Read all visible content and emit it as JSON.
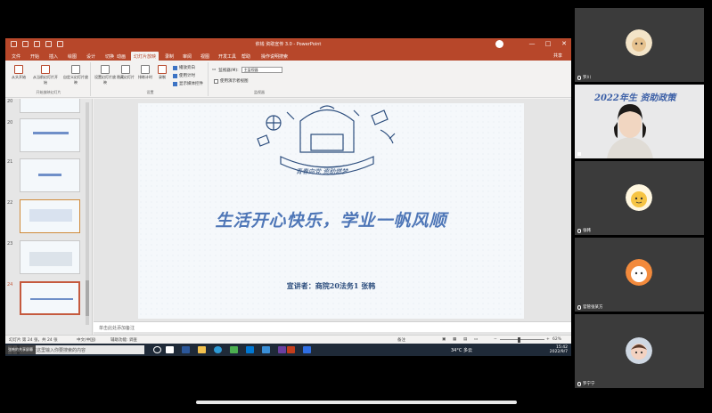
{
  "app": {
    "window_title": "依钱 资助宣传 3.0  -  PowerPoint",
    "tabs": [
      "文件",
      "开始",
      "插入",
      "绘图",
      "设计",
      "切换",
      "动画",
      "幻灯片放映",
      "录制",
      "审阅",
      "视图",
      "开发工具",
      "帮助",
      "操作说明搜索"
    ],
    "active_tab": "幻灯片放映",
    "share_label": "共享",
    "window_controls": [
      "—",
      "□",
      "✕"
    ]
  },
  "ribbon": {
    "groups": [
      {
        "label": "开始放映幻灯片",
        "buttons": [
          "从头开始",
          "从当前幻灯片开始",
          "自定义幻灯片放映"
        ]
      },
      {
        "label": "设置",
        "buttons": [
          "设置幻灯片放映",
          "隐藏幻灯片",
          "排练计时",
          "录制"
        ]
      },
      {
        "label": "监视器",
        "buttons": []
      }
    ],
    "checkboxes": [
      {
        "label": "播放旁白",
        "checked": true
      },
      {
        "label": "使用计时",
        "checked": true
      },
      {
        "label": "显示媒体控件",
        "checked": true
      }
    ],
    "monitor": {
      "label": "监视器(M):",
      "value": "主监视器"
    },
    "presenter_view": {
      "label": "使用演示者视图",
      "checked": false
    }
  },
  "slides": {
    "numbers": [
      "20",
      "21",
      "22",
      "23",
      "24"
    ],
    "selected": "24"
  },
  "current_slide": {
    "banner": "青春向党 资助燃梦",
    "title": "生活开心快乐，学业一帆风顺",
    "presenter": "宣讲者：商院20法务1  张韩"
  },
  "notes_placeholder": "单击此处添加备注",
  "statusbar": {
    "slide_info": "幻灯片 第 24 张，共 24 张",
    "language": "中文(中国)",
    "accessibility": "辅助功能: 调查",
    "notes": "备注",
    "zoom": "62%"
  },
  "taskbar": {
    "search_placeholder": "在这里输入你要搜索的内容",
    "weather": "34°C 多云",
    "time": "15:42",
    "date": "2022/9/7",
    "sharing_label": "张韩的共享屏幕"
  },
  "participants": [
    {
      "name": "罗川"
    },
    {
      "name": "",
      "banner": "2022年生 资助政策"
    },
    {
      "name": "张韩"
    },
    {
      "name": "官管张某方"
    },
    {
      "name": "罗宁宁"
    }
  ],
  "colors": {
    "ppt_red": "#b7472a",
    "slide_title_blue": "#4e76b7",
    "slide_text_navy": "#2d4e7e",
    "tile_bg": "#3b3b3b"
  }
}
